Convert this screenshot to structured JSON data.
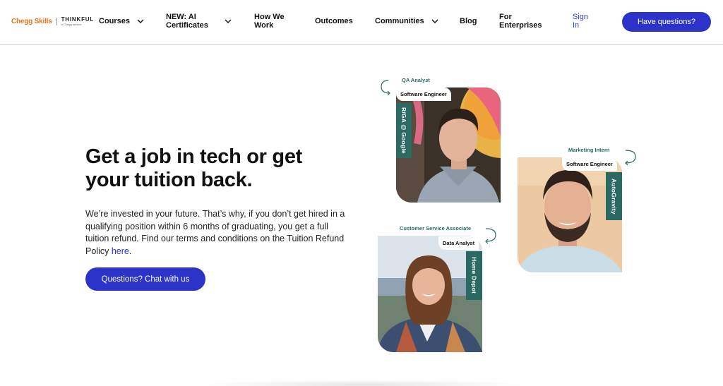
{
  "header": {
    "brand_primary": "Chegg Skills",
    "brand_secondary": "THINKFUL",
    "brand_secondary_sub": "a Chegg service",
    "nav": {
      "courses": "Courses",
      "ai_certificates_line1": "NEW: AI",
      "ai_certificates_line2": "Certificates",
      "how_we_work_line1": "How We",
      "how_we_work_line2": "Work",
      "outcomes": "Outcomes",
      "communities": "Communities",
      "blog": "Blog",
      "enterprises_line1": "For",
      "enterprises_line2": "Enterprises",
      "signin_line1": "Sign",
      "signin_line2": "In"
    },
    "cta": "Have questions?"
  },
  "hero": {
    "title": "Get a job in tech or get your tuition back.",
    "body": "We’re invested in your future. That’s why, if you don’t get hired in a qualifying position within 6 months of graduating, you get a full tuition refund. Find our terms and conditions on the Tuition Refund Policy ",
    "link_text": "here",
    "body_end": ".",
    "chat_button": "Questions? Chat with us"
  },
  "profiles": [
    {
      "previous_role": "QA Analyst",
      "new_role": "Software Engineer",
      "company": "R/GA @ Google"
    },
    {
      "previous_role": "Marketing Intern",
      "new_role": "Software Engineer",
      "company": "AutoGravity"
    },
    {
      "previous_role": "Customer Service Associate",
      "new_role": "Data Analyst",
      "company": "Home Depot"
    }
  ],
  "colors": {
    "brand_orange": "#e8721c",
    "primary_blue": "#2b33c9",
    "tag_teal": "#2a6a63"
  }
}
